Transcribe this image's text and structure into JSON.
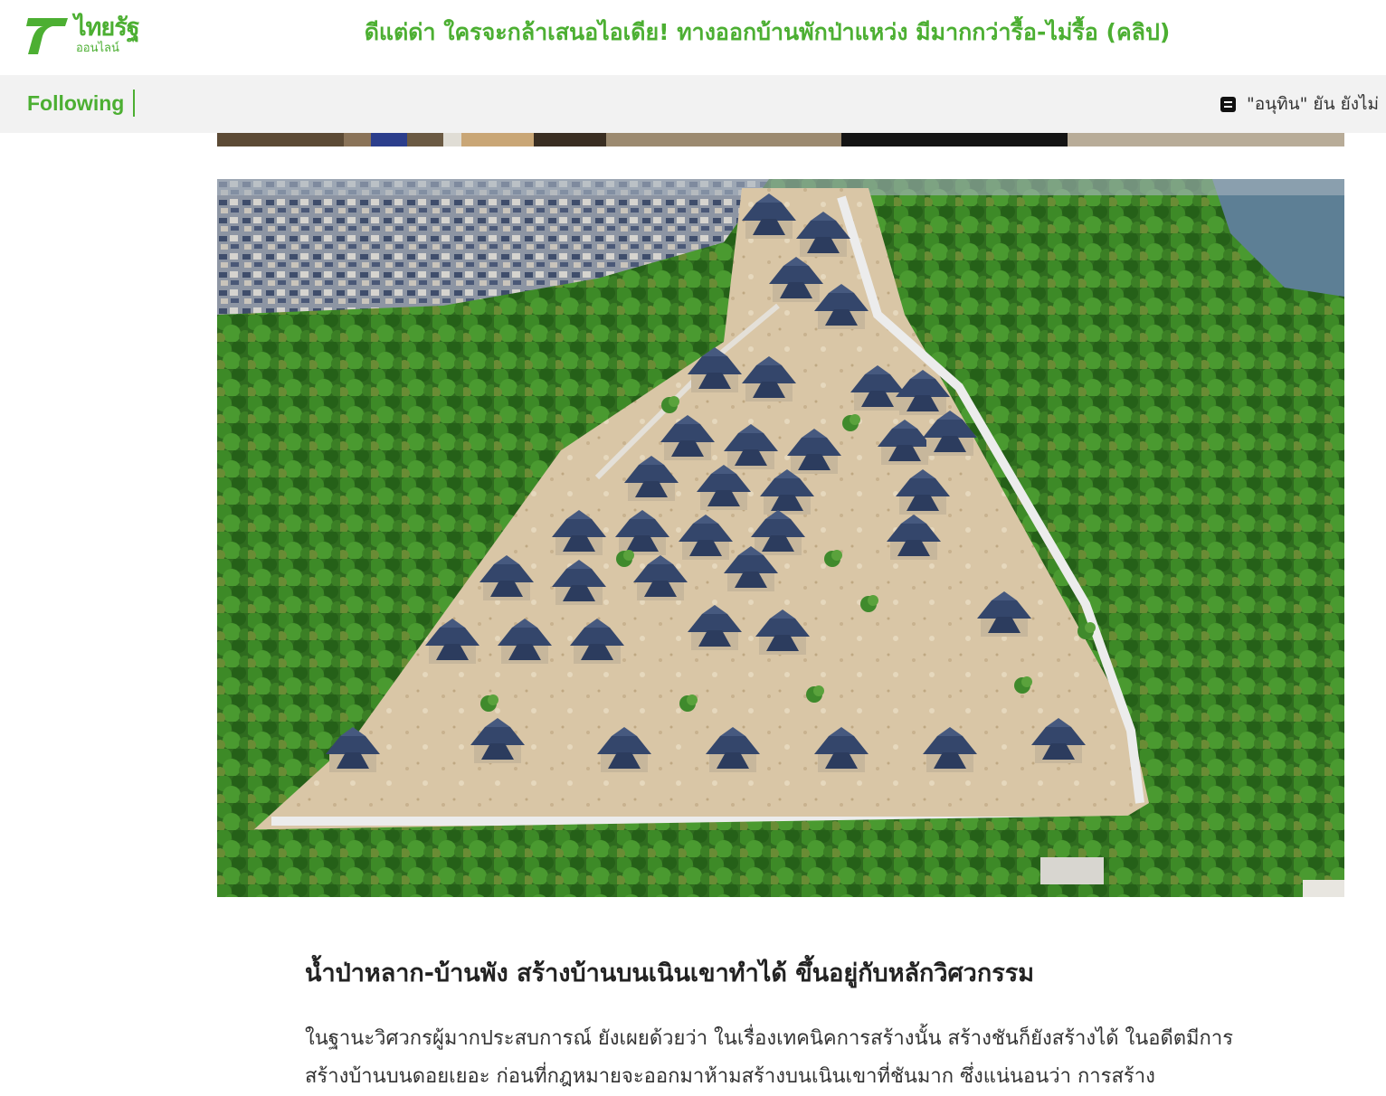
{
  "header": {
    "logo_brand": "ไทยรัฐ",
    "logo_sub": "ออนไลน์",
    "headline": "ดีแต่ด่า ใครจะกล้าเสนอไอเดีย! ทางออกบ้านพักป่าแหว่ง มีมากกว่ารื้อ-ไม่รื้อ (คลิป)"
  },
  "follow_bar": {
    "following_label": "Following",
    "ticker_text": "\"อนุทิน\" ยัน ยังไม่"
  },
  "article": {
    "section_heading": "น้ำป่าหลาก-บ้านพัง สร้างบ้านบนเนินเขาทำได้ ขึ้นอยู่กับหลักวิศวกรรม",
    "paragraph": "ในฐานะวิศวกรผู้มากประสบการณ์ ยังเผยด้วยว่า ในเรื่องเทคนิคการสร้างนั้น สร้างชันก็ยังสร้างได้ ในอดีตมีการสร้างบ้านบนดอยเยอะ ก่อนที่กฎหมายจะออกมาห้ามสร้างบนเนินเขาที่ชันมาก ซึ่งแน่นอนว่า การสร้าง"
  },
  "colors": {
    "brand_green": "#4caf32",
    "follow_bar_bg": "#f2f2f2",
    "roof_blue": "#3d4f73",
    "forest_green": "#2f6b1f"
  },
  "icons": {
    "ticker_icon": "news-icon"
  }
}
